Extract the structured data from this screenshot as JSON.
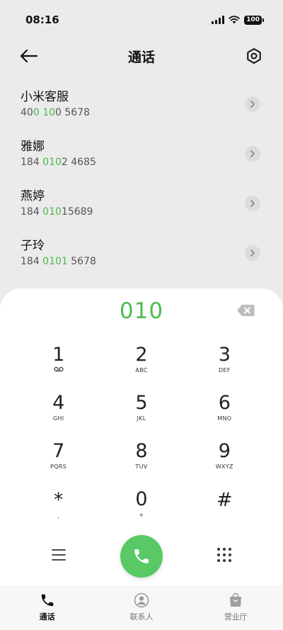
{
  "status_bar": {
    "time": "08:16",
    "battery": "100"
  },
  "header": {
    "title": "通话"
  },
  "contacts": [
    {
      "name": "小米客服",
      "number_parts": [
        "40",
        "0",
        " ",
        "10",
        "0 5678"
      ],
      "highlight": [
        false,
        true,
        false,
        true,
        false
      ]
    },
    {
      "name": "雅娜",
      "number_parts": [
        "184 ",
        "010",
        "2 4685"
      ],
      "highlight": [
        false,
        true,
        false
      ]
    },
    {
      "name": "燕婷",
      "number_parts": [
        "184 ",
        "010",
        "15689"
      ],
      "highlight": [
        false,
        true,
        false
      ]
    },
    {
      "name": "子玲",
      "number_parts": [
        "184 ",
        "0101",
        " 5678"
      ],
      "highlight": [
        false,
        true,
        false
      ]
    }
  ],
  "dialer": {
    "input": "010",
    "keys": [
      {
        "digit": "1",
        "letters": ""
      },
      {
        "digit": "2",
        "letters": "ABC"
      },
      {
        "digit": "3",
        "letters": "DEF"
      },
      {
        "digit": "4",
        "letters": "GHI"
      },
      {
        "digit": "5",
        "letters": "JKL"
      },
      {
        "digit": "6",
        "letters": "MNO"
      },
      {
        "digit": "7",
        "letters": "PQRS"
      },
      {
        "digit": "8",
        "letters": "TUV"
      },
      {
        "digit": "9",
        "letters": "WXYZ"
      },
      {
        "digit": "*",
        "letters": ","
      },
      {
        "digit": "0",
        "letters": "+"
      },
      {
        "digit": "#",
        "letters": ""
      }
    ]
  },
  "bottom_nav": [
    {
      "label": "通话",
      "icon": "phone-icon",
      "active": true
    },
    {
      "label": "联系人",
      "icon": "contacts-icon",
      "active": false
    },
    {
      "label": "营业厅",
      "icon": "shopping-bag-icon",
      "active": false
    }
  ],
  "colors": {
    "accent": "#4cbc4e",
    "call_button": "#59c966"
  }
}
